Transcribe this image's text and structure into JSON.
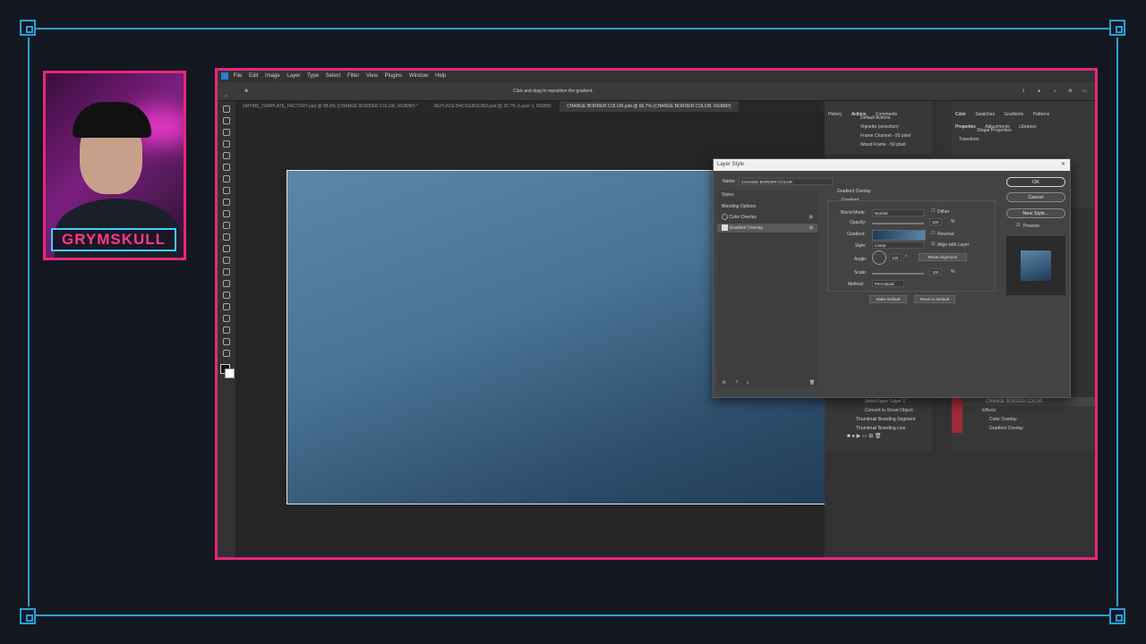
{
  "overlay": {
    "brand_text": "GRYMSKULL",
    "accent_color": "#e8267a",
    "frame_color": "#2a9fd6"
  },
  "photoshop": {
    "menu": [
      "File",
      "Edit",
      "Image",
      "Layer",
      "Type",
      "Select",
      "Filter",
      "View",
      "Plugins",
      "Window",
      "Help"
    ],
    "status_hint": "Click and drag to reposition the gradient.",
    "tabs": [
      {
        "label": "GRYMS_TEMPLATE_FACTORY.psd @ 98.9% (CHANGE BORDER COLOR, RGB/8#) *",
        "active": false
      },
      {
        "label": "REPLACE BACKGROUND.psd @ 20.7% (Layer 1, RGB/8)",
        "active": false
      },
      {
        "label": "CHANGE BORDER COLOR.psb @ 66.7% (CHANGE BORDER COLOR, RGB/8#)",
        "active": true
      }
    ],
    "actions_panel": {
      "tabs": [
        "History",
        "Actions",
        "Comments"
      ],
      "items": [
        "Default Actions",
        "Vignette (selection)",
        "Frame Channel - 50 pixel",
        "Wood Frame - 50 pixel"
      ],
      "lower_items": [
        "Select layer 'Layer 1'",
        "Convert to Smart Object",
        "Thumbnail Branding Segment",
        "Thumbnail Branding Live"
      ]
    },
    "properties_panel": {
      "top_tabs": [
        "Color",
        "Swatches",
        "Gradients",
        "Patterns"
      ],
      "tabs": [
        "Properties",
        "Adjustments",
        "Libraries"
      ],
      "shape_label": "Shape Properties",
      "transform_label": "Transform"
    },
    "layers_panel": {
      "layer_name": "CHANGE BORDER COLOR",
      "effects_label": "Effects",
      "effects": [
        "Color Overlay",
        "Gradient Overlay"
      ]
    }
  },
  "layer_style": {
    "title": "Layer Style",
    "name_label": "Name:",
    "name_value": "CHANGE BORDER COLOR",
    "styles_label": "Styles",
    "blending_label": "Blending Options",
    "effects": [
      {
        "label": "Color Overlay",
        "checked": false
      },
      {
        "label": "Gradient Overlay",
        "checked": true
      }
    ],
    "section_title": "Gradient Overlay",
    "subsection": "Gradient",
    "blend_mode_label": "Blend Mode:",
    "blend_mode_value": "Normal",
    "dither_label": "Dither",
    "opacity_label": "Opacity:",
    "opacity_value": "100",
    "gradient_label": "Gradient:",
    "reverse_label": "Reverse",
    "style_label": "Style:",
    "style_value": "Linear",
    "align_label": "Align with Layer",
    "angle_label": "Angle:",
    "angle_value": "125",
    "reset_alignment": "Reset Alignment",
    "scale_label": "Scale:",
    "scale_value": "100",
    "method_label": "Method:",
    "method_value": "Perceptual",
    "make_default": "Make Default",
    "reset_default": "Reset to Default",
    "ok": "OK",
    "cancel": "Cancel",
    "new_style": "New Style...",
    "preview": "Preview",
    "percent": "%",
    "degree": "°",
    "fx": "fx"
  }
}
